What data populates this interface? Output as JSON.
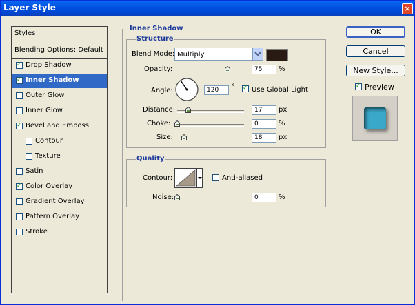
{
  "window": {
    "title": "Layer Style",
    "close_glyph": "×"
  },
  "sidebar": {
    "header": "Styles",
    "blending": "Blending Options: Default",
    "items": [
      {
        "label": "Drop Shadow",
        "checked": true,
        "selected": false,
        "indent": false
      },
      {
        "label": "Inner Shadow",
        "checked": true,
        "selected": true,
        "indent": false
      },
      {
        "label": "Outer Glow",
        "checked": false,
        "selected": false,
        "indent": false
      },
      {
        "label": "Inner Glow",
        "checked": false,
        "selected": false,
        "indent": false
      },
      {
        "label": "Bevel and Emboss",
        "checked": true,
        "selected": false,
        "indent": false
      },
      {
        "label": "Contour",
        "checked": false,
        "selected": false,
        "indent": true
      },
      {
        "label": "Texture",
        "checked": false,
        "selected": false,
        "indent": true
      },
      {
        "label": "Satin",
        "checked": false,
        "selected": false,
        "indent": false
      },
      {
        "label": "Color Overlay",
        "checked": true,
        "selected": false,
        "indent": false
      },
      {
        "label": "Gradient Overlay",
        "checked": false,
        "selected": false,
        "indent": false
      },
      {
        "label": "Pattern Overlay",
        "checked": false,
        "selected": false,
        "indent": false
      },
      {
        "label": "Stroke",
        "checked": false,
        "selected": false,
        "indent": false
      }
    ]
  },
  "inner_shadow": {
    "title": "Inner Shadow",
    "structure": {
      "title": "Structure",
      "blend_mode_label": "Blend Mode:",
      "blend_mode_value": "Multiply",
      "shadow_color": "#2a1a14",
      "opacity_label": "Opacity:",
      "opacity_value": "75",
      "opacity_unit": "%",
      "opacity_level": 0.75,
      "angle_label": "Angle:",
      "angle_value": "120",
      "angle_unit": "°",
      "use_global_light_label": "Use Global Light",
      "use_global_light": true,
      "distance_label": "Distance:",
      "distance_value": "17",
      "distance_unit": "px",
      "distance_level": 0.17,
      "choke_label": "Choke:",
      "choke_value": "0",
      "choke_unit": "%",
      "choke_level": 0,
      "size_label": "Size:",
      "size_value": "18",
      "size_unit": "px",
      "size_level": 0.1
    },
    "quality": {
      "title": "Quality",
      "contour_label": "Contour:",
      "anti_aliased_label": "Anti-aliased",
      "anti_aliased": false,
      "noise_label": "Noise:",
      "noise_value": "0",
      "noise_unit": "%",
      "noise_level": 0
    }
  },
  "buttons": {
    "ok": "OK",
    "cancel": "Cancel",
    "new_style": "New Style...",
    "preview_label": "Preview",
    "preview_checked": true
  },
  "colors": {
    "title_bar": "#0054e3",
    "selection": "#3169c6",
    "section_title": "#1f3c9c",
    "preview_swatch": "#3aa8c8"
  }
}
